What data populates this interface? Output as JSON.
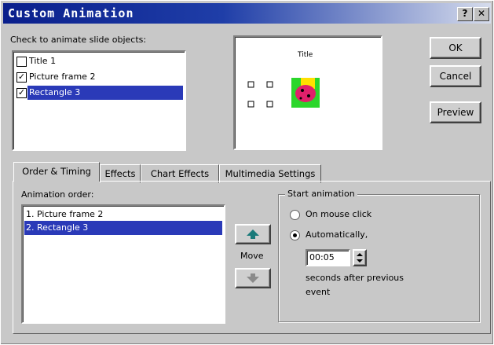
{
  "window": {
    "title": "Custom Animation",
    "help_label": "?",
    "close_label": "✕"
  },
  "objects": {
    "label": "Check to animate slide objects:",
    "items": [
      {
        "label": "Title 1",
        "checked": false,
        "check_mark": ""
      },
      {
        "label": "Picture frame 2",
        "checked": true,
        "check_mark": "✓"
      },
      {
        "label": "Rectangle 3",
        "checked": true,
        "check_mark": "✓",
        "selected": true
      }
    ]
  },
  "preview_pane": {
    "slide_title": "Title"
  },
  "buttons": {
    "ok": "OK",
    "cancel": "Cancel",
    "preview": "Preview"
  },
  "tabs": [
    {
      "label": "Order & Timing",
      "active": true
    },
    {
      "label": "Effects"
    },
    {
      "label": "Chart Effects"
    },
    {
      "label": "Multimedia Settings"
    }
  ],
  "order": {
    "label": "Animation order:",
    "items": [
      "1. Picture frame 2",
      "2. Rectangle 3"
    ],
    "move_label": "Move",
    "up_icon": "arrow-up-icon",
    "down_icon": "arrow-down-icon"
  },
  "start": {
    "group_label": "Start animation",
    "on_click": "On mouse click",
    "automatically": "Automatically,",
    "time_value": "00:05",
    "after_text_1": "seconds after previous",
    "after_text_2": "event"
  },
  "colors": {
    "titlebar": "#0a1f8c",
    "selection": "#2a3ab8"
  }
}
